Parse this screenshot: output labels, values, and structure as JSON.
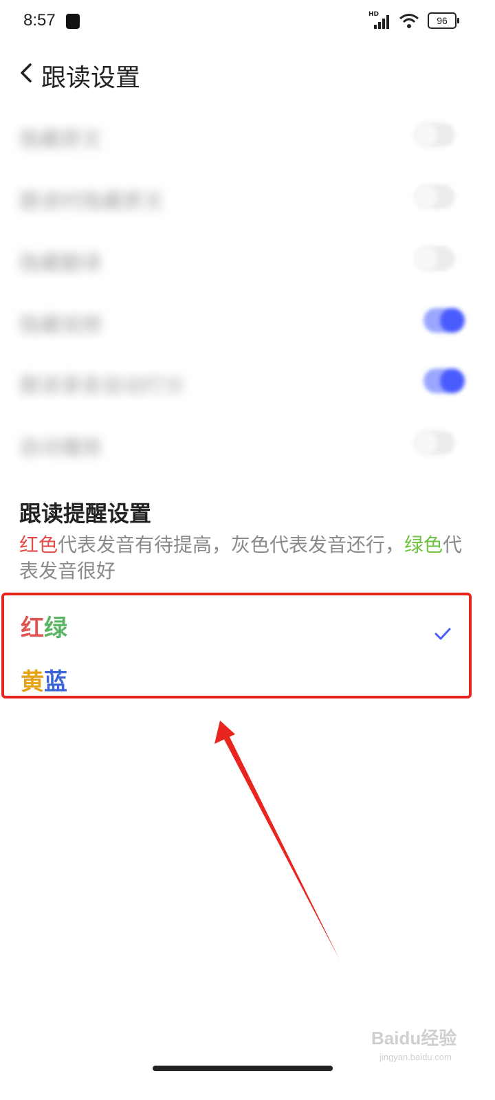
{
  "status_bar": {
    "time": "8:57",
    "network_label": "HD",
    "battery": "96"
  },
  "header": {
    "title": "跟读设置"
  },
  "settings": [
    {
      "label": "隐藏原文",
      "enabled": false
    },
    {
      "label": "跟读时隐藏原文",
      "enabled": false
    },
    {
      "label": "隐藏翻译",
      "enabled": false
    },
    {
      "label": "隐藏视频",
      "enabled": true
    },
    {
      "label": "跟读录音自动打分",
      "enabled": true
    },
    {
      "label": "自动播放",
      "enabled": false
    }
  ],
  "reminder": {
    "title": "跟读提醒设置",
    "desc_red": "红色",
    "desc_middle": "代表发音有待提高，灰色代表发音还行，",
    "desc_green": "绿色",
    "desc_end": "代表发音很好"
  },
  "options": [
    {
      "part1": "红",
      "part2": "绿",
      "selected": true
    },
    {
      "part1": "黄",
      "part2": "蓝",
      "selected": false
    }
  ],
  "colors": {
    "accent": "#4a5cff",
    "highlight_box": "#e8261f",
    "red": "#e05353",
    "green": "#5bb464",
    "yellow": "#e6a316",
    "blue": "#3c66d8"
  },
  "watermark": {
    "brand": "Baidu经验",
    "domain": "jingyan.baidu.com"
  }
}
